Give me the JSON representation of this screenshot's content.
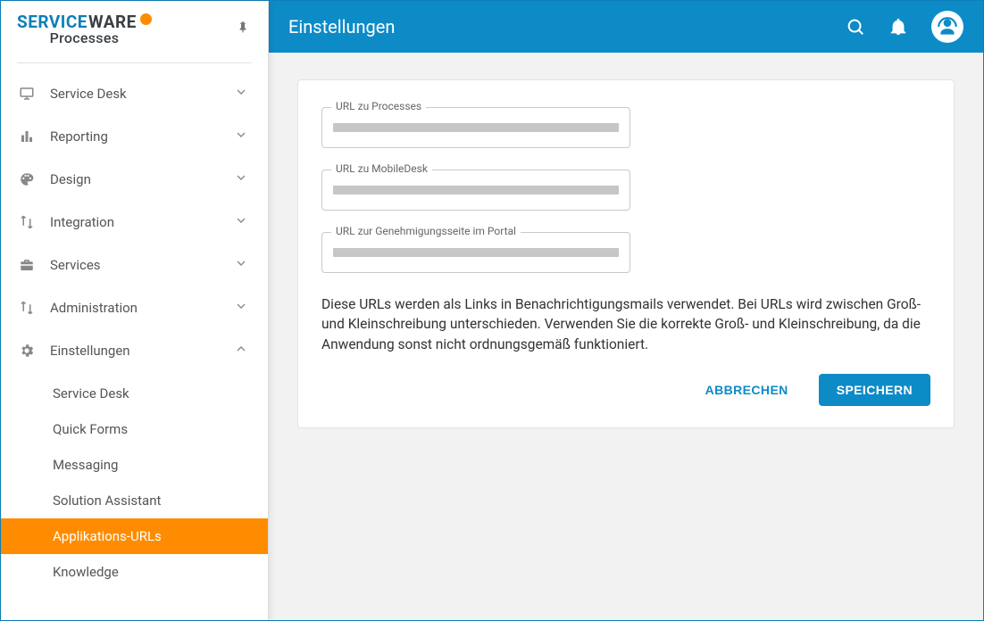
{
  "logo": {
    "service": "SERVICE",
    "ware": "WARE",
    "sub": "Processes"
  },
  "header": {
    "title": "Einstellungen"
  },
  "sidebar": {
    "items": [
      {
        "label": "Service Desk"
      },
      {
        "label": "Reporting"
      },
      {
        "label": "Design"
      },
      {
        "label": "Integration"
      },
      {
        "label": "Services"
      },
      {
        "label": "Administration"
      },
      {
        "label": "Einstellungen"
      }
    ],
    "sub": [
      {
        "label": "Service Desk"
      },
      {
        "label": "Quick Forms"
      },
      {
        "label": "Messaging"
      },
      {
        "label": "Solution Assistant"
      },
      {
        "label": "Applikations-URLs"
      },
      {
        "label": "Knowledge"
      }
    ]
  },
  "form": {
    "fields": [
      {
        "label": "URL zu Processes"
      },
      {
        "label": "URL zu MobileDesk"
      },
      {
        "label": "URL zur Genehmigungsseite im Portal"
      }
    ],
    "help": "Diese URLs werden als Links in Benachrichtigungsmails verwendet. Bei URLs wird zwischen Groß- und Kleinschreibung unterschieden. Verwenden Sie die korrekte Groß- und Kleinschreibung, da die Anwendung sonst nicht ordnungsgemäß funktioniert.",
    "cancel": "ABBRECHEN",
    "save": "SPEICHERN"
  }
}
